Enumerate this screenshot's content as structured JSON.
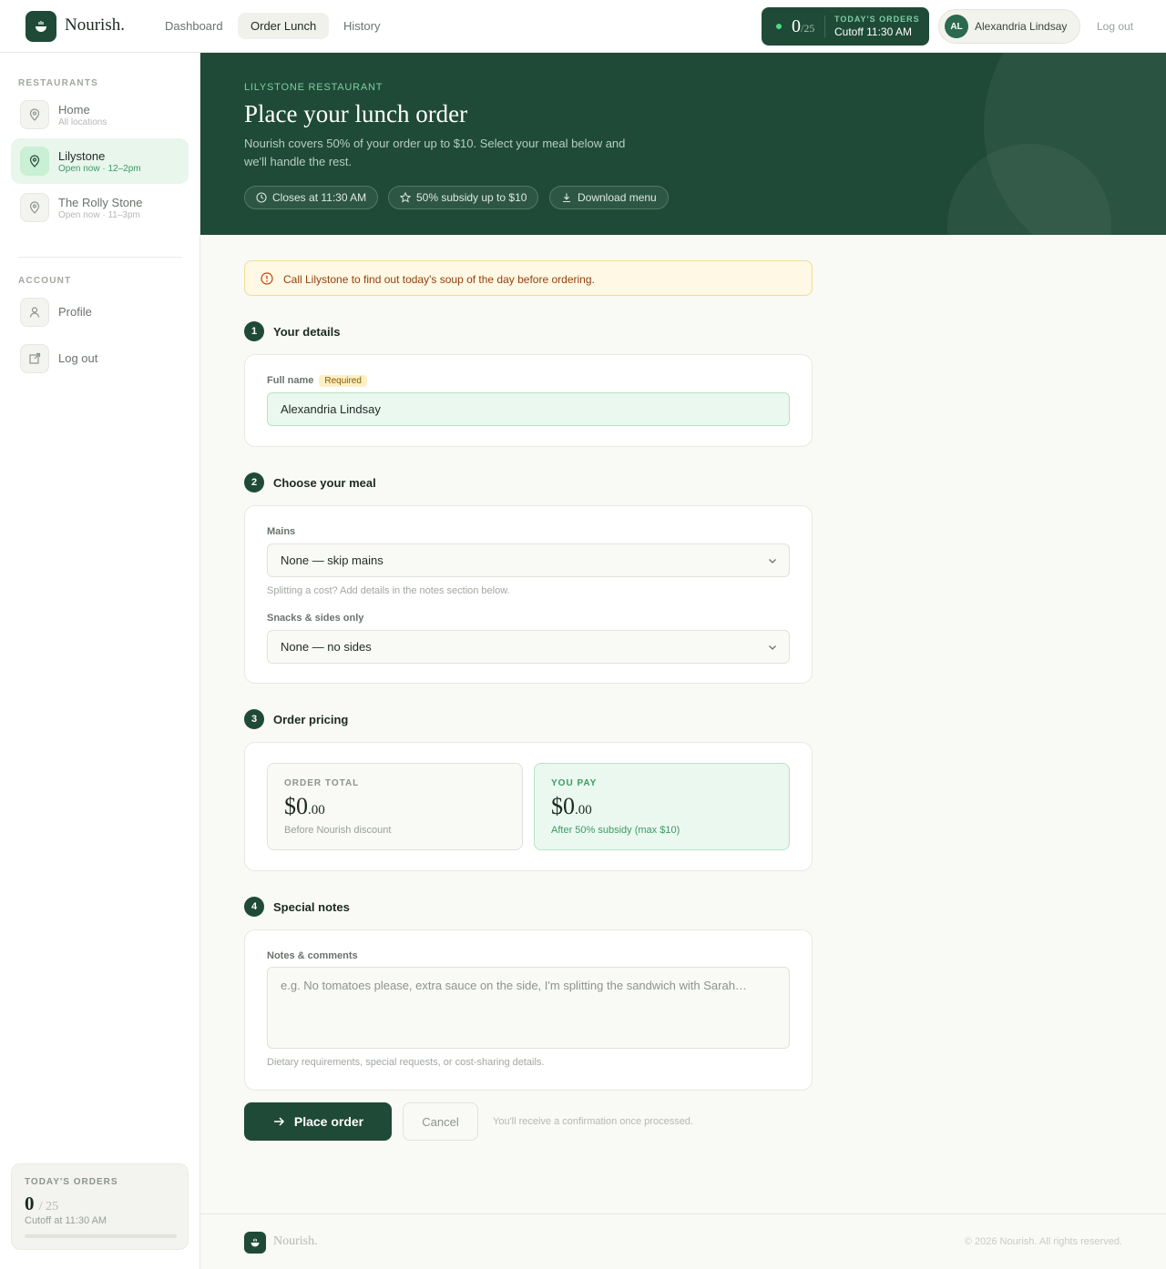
{
  "brand": {
    "name": "Nourish.",
    "logo_icon": "bowl-icon"
  },
  "nav": [
    {
      "label": "Dashboard",
      "active": false
    },
    {
      "label": "Order Lunch",
      "active": true
    },
    {
      "label": "History",
      "active": false
    }
  ],
  "orders_status": {
    "count": "0",
    "limit": "/25",
    "label": "TODAY'S ORDERS",
    "cutoff": "Cutoff 11:30 AM"
  },
  "user": {
    "initials": "AL",
    "name": "Alexandria Lindsay"
  },
  "top_logout": "Log out",
  "sidebar": {
    "restaurants_heading": "RESTAURANTS",
    "restaurants": [
      {
        "name": "Home",
        "sub": "All locations",
        "icon": "map-pin-icon",
        "active": false
      },
      {
        "name": "Lilystone",
        "sub": "Open now · 12–2pm",
        "icon": "map-pin-icon",
        "active": true
      },
      {
        "name": "The Rolly Stone",
        "sub": "Open now · 11–3pm",
        "icon": "map-pin-icon",
        "active": false
      }
    ],
    "account_heading": "ACCOUNT",
    "account": [
      {
        "name": "Profile",
        "icon": "user-icon"
      },
      {
        "name": "Log out",
        "icon": "external-link-icon"
      }
    ],
    "card": {
      "label": "TODAY'S ORDERS",
      "count": "0",
      "limit": "/ 25",
      "cutoff": "Cutoff at 11:30 AM",
      "progress": 0
    }
  },
  "hero": {
    "kicker": "LILYSTONE RESTAURANT",
    "title": "Place your lunch order",
    "subtitle": "Nourish covers 50% of your order up to $10. Select your meal below and we'll handle the rest.",
    "chips": [
      {
        "label": "Closes at 11:30 AM",
        "icon": "clock-icon"
      },
      {
        "label": "50% subsidy up to $10",
        "icon": "star-icon"
      },
      {
        "label": "Download menu",
        "icon": "download-icon"
      }
    ]
  },
  "alert": {
    "text": "Call Lilystone to find out today's soup of the day before ordering.",
    "icon": "alert-circle-icon"
  },
  "steps": {
    "details": {
      "num": "1",
      "title": "Your details"
    },
    "meal": {
      "num": "2",
      "title": "Choose your meal"
    },
    "pricing": {
      "num": "3",
      "title": "Order pricing"
    },
    "notes": {
      "num": "4",
      "title": "Special notes"
    }
  },
  "details": {
    "label": "Full name",
    "required": "Required",
    "value": "Alexandria Lindsay"
  },
  "meal": {
    "mains_label": "Mains",
    "mains_value": "None — skip mains",
    "mains_hint": "Splitting a cost? Add details in the notes section below.",
    "sides_label": "Snacks & sides only",
    "sides_value": "None — no sides"
  },
  "pricing": {
    "total_label": "ORDER TOTAL",
    "total_dollars": "$0",
    "total_cents": ".00",
    "total_sub": "Before Nourish discount",
    "pay_label": "YOU PAY",
    "pay_dollars": "$0",
    "pay_cents": ".00",
    "pay_sub": "After 50% subsidy (max $10)"
  },
  "notes": {
    "label": "Notes & comments",
    "placeholder": "e.g. No tomatoes please, extra sauce on the side, I'm splitting the sandwich with Sarah…",
    "hint": "Dietary requirements, special requests, or cost-sharing details."
  },
  "actions": {
    "submit": "Place order",
    "cancel": "Cancel",
    "note": "You'll receive a confirmation once processed."
  },
  "footer": {
    "name": "Nourish.",
    "copyright": "© 2026 Nourish. All rights reserved."
  },
  "colors": {
    "brand": "#1f4a37",
    "accent": "#4ade80",
    "warning_bg": "#fef8e4"
  }
}
